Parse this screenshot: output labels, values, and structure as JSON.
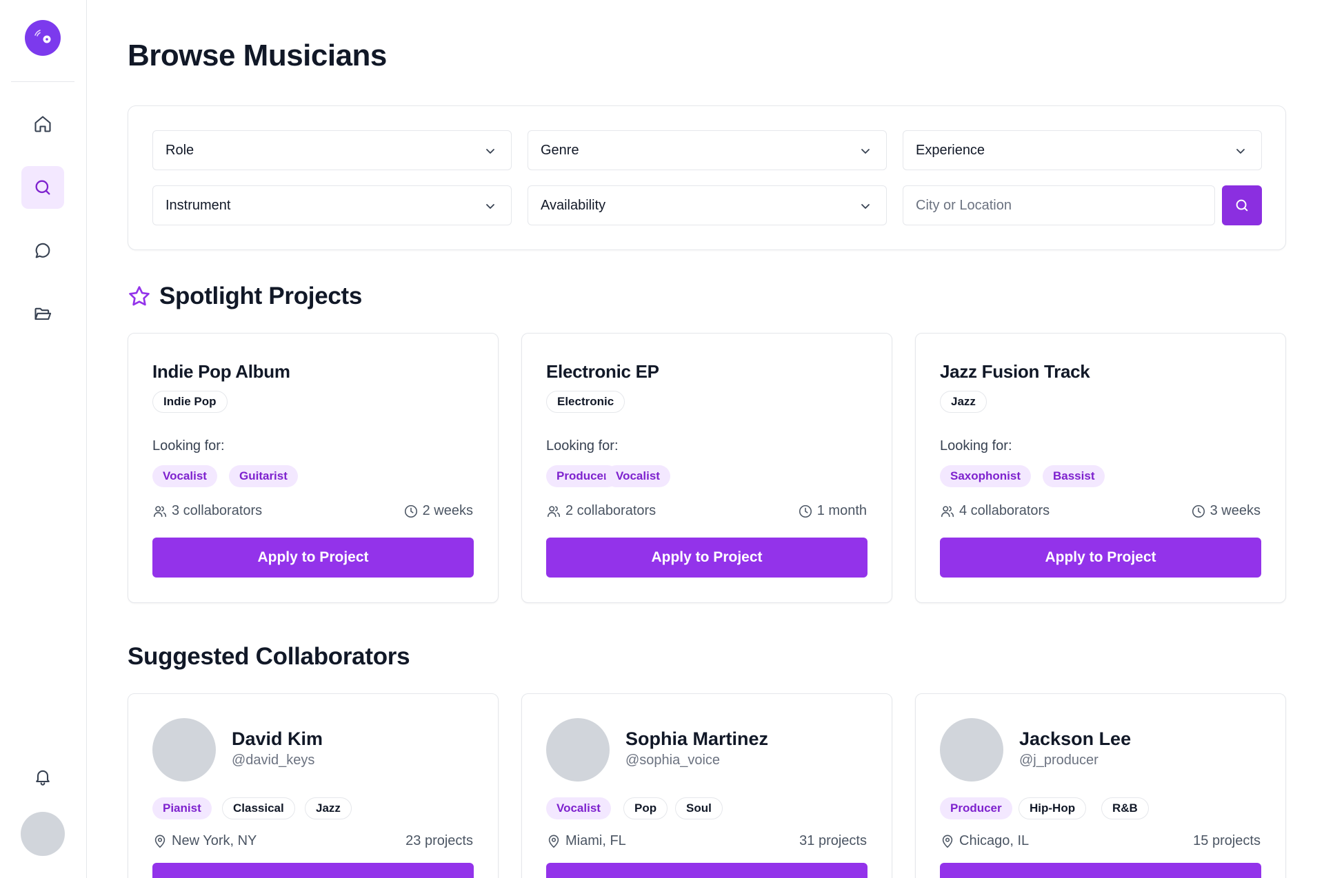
{
  "page": {
    "title": "Browse Musicians"
  },
  "colors": {
    "accent": "#9333ea",
    "accent_light": "#f3e8ff",
    "accent_text": "#7e22ce"
  },
  "sidebar": {
    "items": [
      {
        "icon": "home-icon",
        "active": false
      },
      {
        "icon": "search-icon",
        "active": true
      },
      {
        "icon": "message-icon",
        "active": false
      },
      {
        "icon": "folder-icon",
        "active": false
      }
    ],
    "bottom": [
      {
        "icon": "bell-icon"
      },
      {
        "icon": "user-avatar"
      }
    ]
  },
  "filters": {
    "role": "Role",
    "genre": "Genre",
    "experience": "Experience",
    "instrument": "Instrument",
    "availability": "Availability",
    "location_placeholder": "City or Location"
  },
  "spotlight": {
    "title": "Spotlight Projects",
    "looking_for_label": "Looking for:",
    "apply_label": "Apply to Project",
    "projects": [
      {
        "title": "Indie Pop Album",
        "genre": "Indie Pop",
        "roles": [
          "Vocalist",
          "Guitarist"
        ],
        "collaborators": "3 collaborators",
        "duration": "2 weeks"
      },
      {
        "title": "Electronic EP",
        "genre": "Electronic",
        "roles": [
          "Producer",
          "Vocalist"
        ],
        "collaborators": "2 collaborators",
        "duration": "1 month"
      },
      {
        "title": "Jazz Fusion Track",
        "genre": "Jazz",
        "roles": [
          "Saxophonist",
          "Bassist"
        ],
        "collaborators": "4 collaborators",
        "duration": "3 weeks"
      }
    ]
  },
  "collaborators": {
    "title": "Suggested Collaborators",
    "people": [
      {
        "name": "David Kim",
        "handle": "@david_keys",
        "role": "Pianist",
        "genres": [
          "Classical",
          "Jazz"
        ],
        "location": "New York, NY",
        "projects": "23 projects"
      },
      {
        "name": "Sophia Martinez",
        "handle": "@sophia_voice",
        "role": "Vocalist",
        "genres": [
          "Pop",
          "Soul"
        ],
        "location": "Miami, FL",
        "projects": "31 projects"
      },
      {
        "name": "Jackson Lee",
        "handle": "@j_producer",
        "role": "Producer",
        "genres": [
          "Hip-Hop",
          "R&B"
        ],
        "location": "Chicago, IL",
        "projects": "15 projects"
      }
    ]
  }
}
